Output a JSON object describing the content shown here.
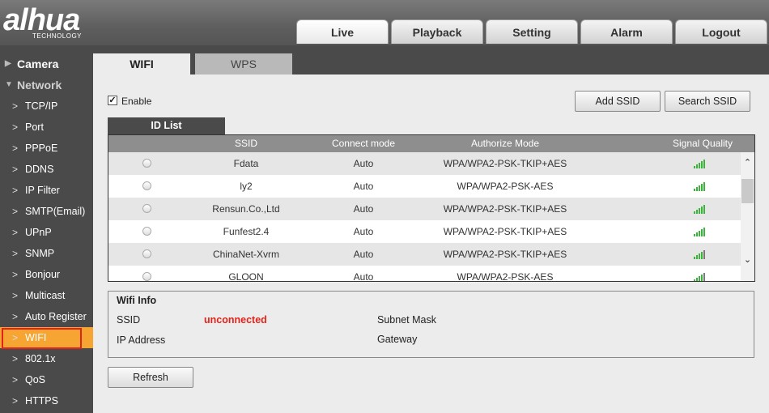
{
  "brand": {
    "name": "alhua",
    "tagline": "TECHNOLOGY"
  },
  "topnav": [
    "Live",
    "Playback",
    "Setting",
    "Alarm",
    "Logout"
  ],
  "sidebar": {
    "categories": [
      "Camera",
      "Network"
    ],
    "items": [
      "TCP/IP",
      "Port",
      "PPPoE",
      "DDNS",
      "IP Filter",
      "SMTP(Email)",
      "UPnP",
      "SNMP",
      "Bonjour",
      "Multicast",
      "Auto Register",
      "WIFI",
      "802.1x",
      "QoS",
      "HTTPS"
    ],
    "active": "WIFI"
  },
  "tabs": {
    "active": "WIFI",
    "other": "WPS"
  },
  "enable": {
    "label": "Enable",
    "checked": true
  },
  "buttons": {
    "add_ssid": "Add SSID",
    "search_ssid": "Search SSID",
    "refresh": "Refresh"
  },
  "id_list": {
    "tab_label": "ID List",
    "columns": [
      "SSID",
      "Connect mode",
      "Authorize Mode",
      "Signal Quality"
    ],
    "rows": [
      {
        "ssid": "Fdata",
        "mode": "Auto",
        "auth": "WPA/WPA2-PSK-TKIP+AES",
        "signal_bars": 5
      },
      {
        "ssid": "ly2",
        "mode": "Auto",
        "auth": "WPA/WPA2-PSK-AES",
        "signal_bars": 5
      },
      {
        "ssid": "Rensun.Co.,Ltd",
        "mode": "Auto",
        "auth": "WPA/WPA2-PSK-TKIP+AES",
        "signal_bars": 5
      },
      {
        "ssid": "Funfest2.4",
        "mode": "Auto",
        "auth": "WPA/WPA2-PSK-TKIP+AES",
        "signal_bars": 5
      },
      {
        "ssid": "ChinaNet-Xvrm",
        "mode": "Auto",
        "auth": "WPA/WPA2-PSK-TKIP+AES",
        "signal_bars": 4
      },
      {
        "ssid": "GLOON",
        "mode": "Auto",
        "auth": "WPA/WPA2-PSK-AES",
        "signal_bars": 4
      }
    ]
  },
  "wifi_info": {
    "title": "Wifi Info",
    "ssid_label": "SSID",
    "ssid_value": "unconnected",
    "ip_label": "IP Address",
    "subnet_label": "Subnet Mask",
    "gateway_label": "Gateway"
  },
  "colors": {
    "accent": "#f7a532",
    "highlight": "#e0241b",
    "signal": "#3cb43c",
    "dark": "#4a4a4a"
  }
}
